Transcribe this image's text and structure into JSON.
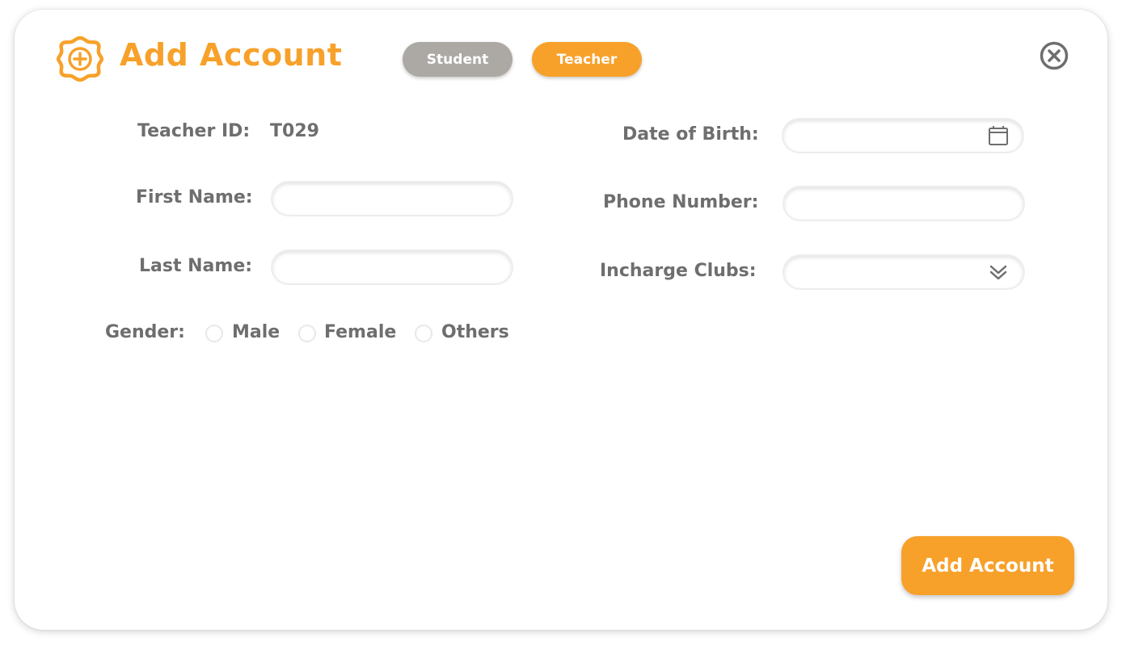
{
  "header": {
    "title": "Add Account",
    "icon": "add-badge-icon",
    "accent_color": "#f7a12a"
  },
  "account_type": {
    "options": [
      "Student",
      "Teacher"
    ],
    "selected": "Teacher",
    "inactive_color": "#aca9a5"
  },
  "close": {
    "icon": "close-circle-icon"
  },
  "form": {
    "teacher_id": {
      "label": "Teacher ID:",
      "value": "T029"
    },
    "first_name": {
      "label": "First Name:",
      "value": ""
    },
    "last_name": {
      "label": "Last Name:",
      "value": ""
    },
    "gender": {
      "label": "Gender:",
      "options": [
        "Male",
        "Female",
        "Others"
      ],
      "selected": null
    },
    "date_of_birth": {
      "label": "Date of Birth:",
      "value": "",
      "icon": "calendar-icon"
    },
    "phone_number": {
      "label": "Phone Number:",
      "value": ""
    },
    "incharge_clubs": {
      "label": "Incharge Clubs:",
      "value": "",
      "icon": "double-chevron-down-icon"
    }
  },
  "submit": {
    "label": "Add Account"
  }
}
